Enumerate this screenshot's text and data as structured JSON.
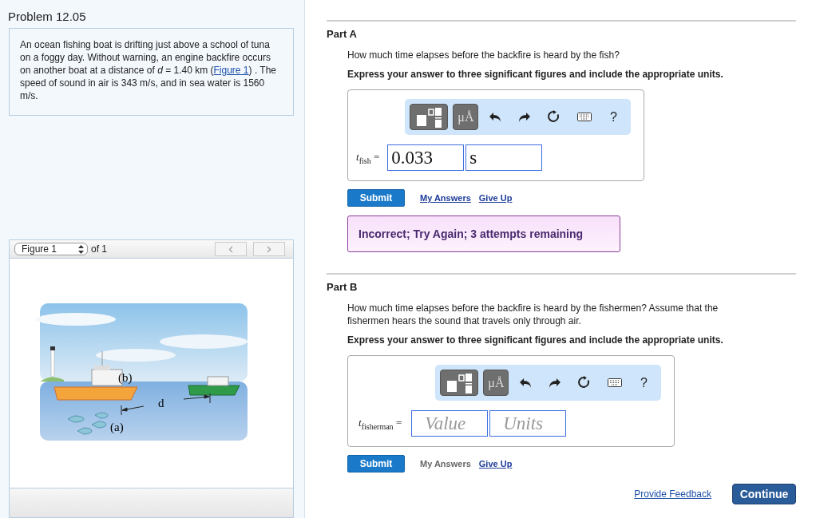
{
  "problem": {
    "title": "Problem 12.05",
    "text_before": "An ocean fishing boat is drifting just above a school of tuna on a foggy day. Without warning, an engine backfire occurs on another boat at a distance of *d* = 1.40  km (",
    "link": "Figure 1",
    "text_after": ") . The speed of sound in air is 343 m/s, and in sea water is 1560 m/s."
  },
  "figure": {
    "selector": "Figure 1",
    "count": "of 1",
    "labels": [
      "(b)",
      "d",
      "(a)"
    ]
  },
  "parts": [
    {
      "title": "Part A",
      "question": "How much time elapses before the backfire is heard by the fish?",
      "instruction": "Express your answer to three significant figures and include the appropriate units.",
      "units_button": "μÅ",
      "help": "?",
      "label": "*t*$_{fish}$ =",
      "value": "0.033",
      "units": "s",
      "submit": "Submit",
      "my_answers": "My Answers",
      "my_answers_enabled": true,
      "give_up": "Give Up",
      "feedback": "Incorrect; Try Again; 3 attempts remaining"
    },
    {
      "title": "Part B",
      "question": "How much time elapses before the backfire is heard by the fishermen? Assume that the fishermen hears the sound that travels only through air.",
      "instruction": "Express your answer to three significant figures and include the appropriate units.",
      "units_button": "μÅ",
      "help": "?",
      "label": "*t*$_{fisherman}$ =",
      "value_placeholder": "Value",
      "units_placeholder": "Units",
      "submit": "Submit",
      "my_answers": "My Answers",
      "my_answers_enabled": false,
      "give_up": "Give Up"
    }
  ],
  "footer": {
    "feedback_link": "Provide Feedback",
    "continue": "Continue"
  }
}
